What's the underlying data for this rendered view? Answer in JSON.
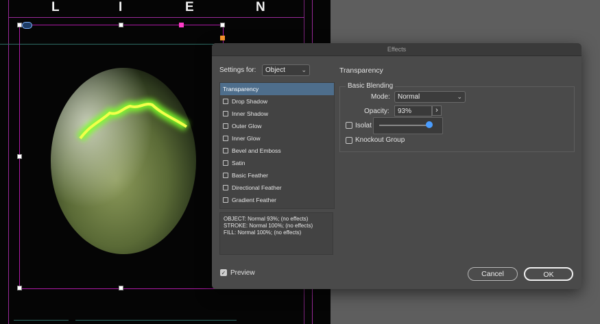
{
  "headline": {
    "letters": [
      "L",
      "I",
      "E",
      "N"
    ]
  },
  "dialog": {
    "title": "Effects",
    "settings_label": "Settings for:",
    "settings_value": "Object",
    "section_title": "Transparency",
    "effects": [
      {
        "label": "Transparency",
        "has_checkbox": false,
        "selected": true
      },
      {
        "label": "Drop Shadow",
        "has_checkbox": true,
        "selected": false
      },
      {
        "label": "Inner Shadow",
        "has_checkbox": true,
        "selected": false
      },
      {
        "label": "Outer Glow",
        "has_checkbox": true,
        "selected": false
      },
      {
        "label": "Inner Glow",
        "has_checkbox": true,
        "selected": false
      },
      {
        "label": "Bevel and Emboss",
        "has_checkbox": true,
        "selected": false
      },
      {
        "label": "Satin",
        "has_checkbox": true,
        "selected": false
      },
      {
        "label": "Basic Feather",
        "has_checkbox": true,
        "selected": false
      },
      {
        "label": "Directional Feather",
        "has_checkbox": true,
        "selected": false
      },
      {
        "label": "Gradient Feather",
        "has_checkbox": true,
        "selected": false
      }
    ],
    "summary": [
      "OBJECT: Normal 93%; (no effects)",
      "STROKE: Normal 100%; (no effects)",
      "FILL: Normal 100%; (no effects)"
    ],
    "basic_blending": {
      "legend": "Basic Blending",
      "mode_label": "Mode:",
      "mode_value": "Normal",
      "opacity_label": "Opacity:",
      "opacity_value": "93%",
      "opacity_fraction": 0.93,
      "isolate_label": "Isolat",
      "knockout_label": "Knockout Group"
    },
    "preview_label": "Preview",
    "preview_checked": true,
    "cancel_label": "Cancel",
    "ok_label": "OK"
  },
  "colors": {
    "accent": "#4a9dff",
    "frame": "#b01aa8",
    "selection": "#4e6e8c"
  }
}
